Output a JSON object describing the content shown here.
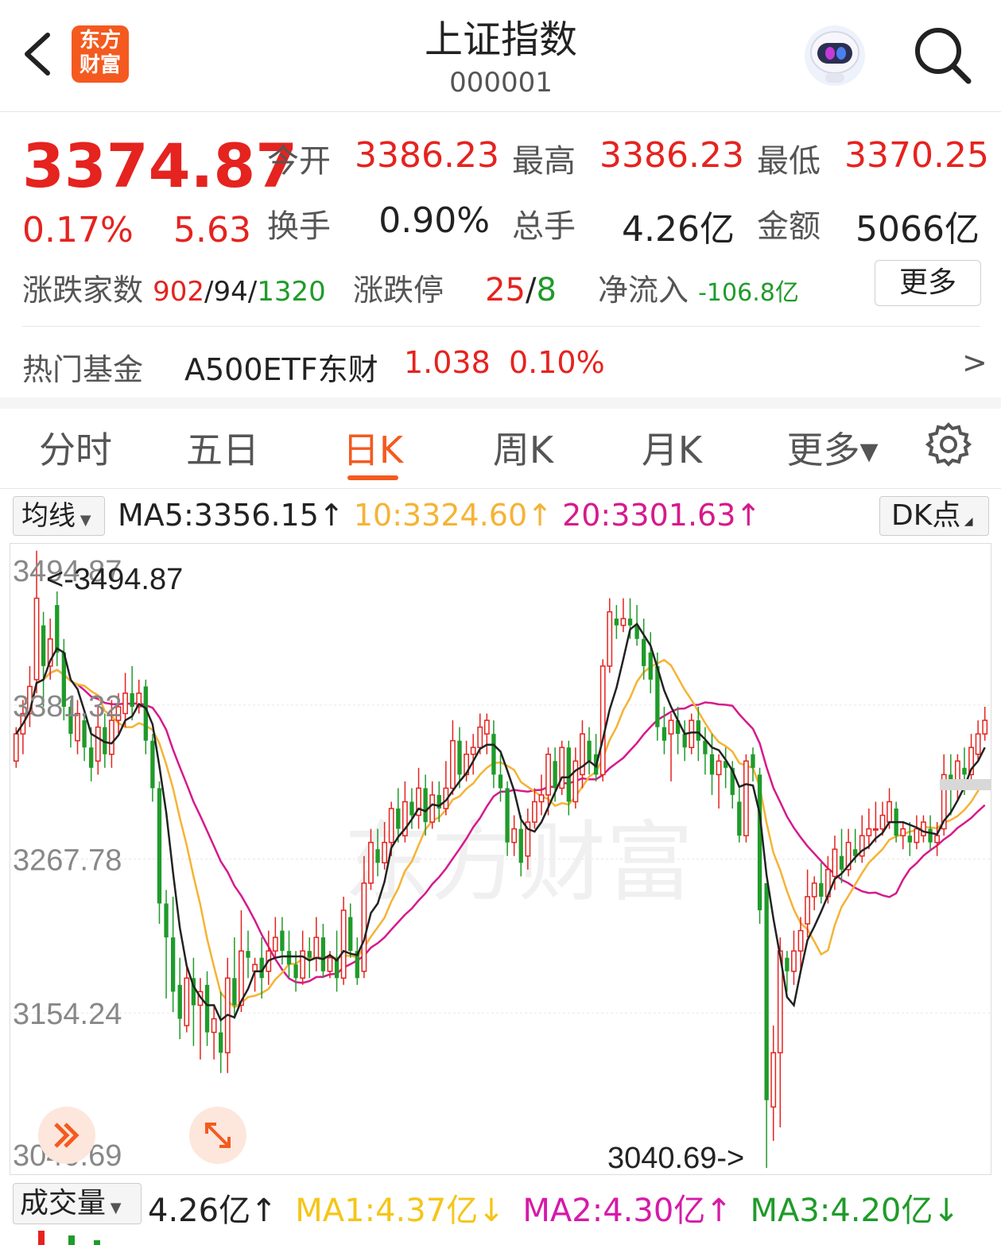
{
  "header": {
    "title": "上证指数",
    "code": "000001",
    "logo_line1": "东方",
    "logo_line2": "财富"
  },
  "quote": {
    "price": "3374.87",
    "change_pct": "0.17%",
    "change": "5.63",
    "open_label": "今开",
    "open": "3386.23",
    "high_label": "最高",
    "high": "3386.23",
    "low_label": "最低",
    "low": "3370.25",
    "turnover_label": "换手",
    "turnover": "0.90%",
    "volume_label": "总手",
    "volume": "4.26亿",
    "amount_label": "金额",
    "amount": "5066亿",
    "breadth_label": "涨跌家数",
    "breadth_up": "902",
    "breadth_flat": "94",
    "breadth_down": "1320",
    "limit_label": "涨跌停",
    "limit_up": "25",
    "limit_down": "8",
    "netflow_label": "净流入",
    "netflow": "-106.8亿",
    "more_label": "更多"
  },
  "fund": {
    "label": "热门基金",
    "name": "A500ETF东财",
    "price": "1.038",
    "pct": "0.10%",
    "arrow": ">"
  },
  "tabs": [
    "分时",
    "五日",
    "日K",
    "周K",
    "月K",
    "更多▾"
  ],
  "active_tab": "日K",
  "ma": {
    "selector": "均线",
    "ma5": "MA5:3356.15↑",
    "ma10": "10:3324.60↑",
    "ma20": "20:3301.63↑",
    "dk": "DK点"
  },
  "volume_bar": {
    "selector": "成交量",
    "value": "4.26亿↑",
    "ma1": "MA1:4.37亿↓",
    "ma2": "MA2:4.30亿↑",
    "ma3": "MA3:4.20亿↓"
  },
  "colors": {
    "up": "#e5231f",
    "down": "#1f9b2a",
    "ma5": "#222222",
    "ma10": "#f5b335",
    "ma20": "#d61a8c",
    "accent": "#f45a1f"
  },
  "chart_data": {
    "type": "candlestick",
    "y_ticks": [
      "3494.87",
      "3381.32",
      "3267.78",
      "3154.24",
      "3040.69"
    ],
    "ylim": [
      3040.69,
      3494.87
    ],
    "max_label": "<-3494.87",
    "min_label": "3040.69->",
    "watermark": "东方财富",
    "candles": [
      [
        3340,
        3360,
        3335,
        3365
      ],
      [
        3360,
        3375,
        3345,
        3385
      ],
      [
        3375,
        3395,
        3365,
        3410
      ],
      [
        3400,
        3460,
        3390,
        3495
      ],
      [
        3440,
        3410,
        3380,
        3450
      ],
      [
        3410,
        3430,
        3400,
        3445
      ],
      [
        3455,
        3420,
        3410,
        3465
      ],
      [
        3420,
        3380,
        3370,
        3430
      ],
      [
        3380,
        3360,
        3350,
        3385
      ],
      [
        3355,
        3375,
        3345,
        3385
      ],
      [
        3370,
        3350,
        3340,
        3375
      ],
      [
        3350,
        3335,
        3325,
        3365
      ],
      [
        3340,
        3365,
        3330,
        3380
      ],
      [
        3365,
        3345,
        3335,
        3375
      ],
      [
        3345,
        3370,
        3335,
        3385
      ],
      [
        3370,
        3380,
        3360,
        3390
      ],
      [
        3375,
        3390,
        3365,
        3405
      ],
      [
        3390,
        3380,
        3370,
        3410
      ],
      [
        3380,
        3390,
        3375,
        3400
      ],
      [
        3395,
        3355,
        3345,
        3400
      ],
      [
        3355,
        3320,
        3310,
        3360
      ],
      [
        3320,
        3235,
        3220,
        3325
      ],
      [
        3235,
        3210,
        3165,
        3245
      ],
      [
        3210,
        3170,
        3155,
        3240
      ],
      [
        3175,
        3150,
        3135,
        3195
      ],
      [
        3145,
        3180,
        3140,
        3190
      ],
      [
        3180,
        3160,
        3130,
        3195
      ],
      [
        3160,
        3170,
        3120,
        3180
      ],
      [
        3175,
        3140,
        3130,
        3185
      ],
      [
        3140,
        3150,
        3120,
        3160
      ],
      [
        3140,
        3125,
        3110,
        3170
      ],
      [
        3125,
        3180,
        3110,
        3195
      ],
      [
        3180,
        3160,
        3150,
        3210
      ],
      [
        3160,
        3200,
        3155,
        3230
      ],
      [
        3200,
        3195,
        3180,
        3215
      ],
      [
        3185,
        3190,
        3170,
        3195
      ],
      [
        3195,
        3180,
        3165,
        3210
      ],
      [
        3185,
        3200,
        3175,
        3215
      ],
      [
        3200,
        3210,
        3195,
        3225
      ],
      [
        3215,
        3200,
        3190,
        3225
      ],
      [
        3200,
        3190,
        3180,
        3215
      ],
      [
        3190,
        3180,
        3170,
        3200
      ],
      [
        3180,
        3200,
        3175,
        3215
      ],
      [
        3200,
        3195,
        3180,
        3210
      ],
      [
        3195,
        3210,
        3185,
        3225
      ],
      [
        3210,
        3185,
        3180,
        3220
      ],
      [
        3185,
        3195,
        3180,
        3200
      ],
      [
        3195,
        3180,
        3170,
        3215
      ],
      [
        3180,
        3230,
        3175,
        3240
      ],
      [
        3225,
        3200,
        3195,
        3235
      ],
      [
        3200,
        3180,
        3175,
        3210
      ],
      [
        3185,
        3250,
        3180,
        3270
      ],
      [
        3250,
        3280,
        3245,
        3290
      ],
      [
        3275,
        3265,
        3255,
        3290
      ],
      [
        3265,
        3280,
        3260,
        3295
      ],
      [
        3280,
        3305,
        3270,
        3310
      ],
      [
        3305,
        3290,
        3280,
        3320
      ],
      [
        3285,
        3310,
        3280,
        3325
      ],
      [
        3310,
        3300,
        3290,
        3320
      ],
      [
        3300,
        3320,
        3290,
        3335
      ],
      [
        3320,
        3295,
        3285,
        3330
      ],
      [
        3295,
        3315,
        3290,
        3325
      ],
      [
        3315,
        3305,
        3295,
        3325
      ],
      [
        3305,
        3320,
        3300,
        3340
      ],
      [
        3320,
        3355,
        3315,
        3370
      ],
      [
        3355,
        3330,
        3320,
        3365
      ],
      [
        3330,
        3345,
        3325,
        3355
      ],
      [
        3345,
        3350,
        3330,
        3360
      ],
      [
        3350,
        3365,
        3345,
        3375
      ],
      [
        3360,
        3370,
        3345,
        3375
      ],
      [
        3360,
        3330,
        3320,
        3370
      ],
      [
        3330,
        3320,
        3310,
        3345
      ],
      [
        3320,
        3280,
        3270,
        3325
      ],
      [
        3280,
        3290,
        3270,
        3300
      ],
      [
        3290,
        3265,
        3255,
        3300
      ],
      [
        3270,
        3295,
        3260,
        3305
      ],
      [
        3295,
        3310,
        3290,
        3320
      ],
      [
        3310,
        3315,
        3300,
        3330
      ],
      [
        3315,
        3345,
        3300,
        3350
      ],
      [
        3340,
        3320,
        3310,
        3350
      ],
      [
        3320,
        3350,
        3315,
        3355
      ],
      [
        3350,
        3310,
        3300,
        3355
      ],
      [
        3310,
        3340,
        3305,
        3350
      ],
      [
        3330,
        3360,
        3320,
        3370
      ],
      [
        3355,
        3340,
        3330,
        3365
      ],
      [
        3345,
        3330,
        3325,
        3360
      ],
      [
        3330,
        3410,
        3325,
        3415
      ],
      [
        3410,
        3450,
        3405,
        3460
      ],
      [
        3445,
        3440,
        3430,
        3455
      ],
      [
        3440,
        3445,
        3435,
        3460
      ],
      [
        3445,
        3440,
        3430,
        3460
      ],
      [
        3440,
        3430,
        3425,
        3455
      ],
      [
        3430,
        3410,
        3400,
        3445
      ],
      [
        3420,
        3400,
        3390,
        3435
      ],
      [
        3410,
        3365,
        3355,
        3420
      ],
      [
        3365,
        3355,
        3345,
        3380
      ],
      [
        3360,
        3370,
        3325,
        3375
      ],
      [
        3370,
        3360,
        3345,
        3380
      ],
      [
        3360,
        3350,
        3340,
        3370
      ],
      [
        3350,
        3370,
        3345,
        3375
      ],
      [
        3370,
        3355,
        3340,
        3380
      ],
      [
        3355,
        3345,
        3330,
        3365
      ],
      [
        3345,
        3330,
        3315,
        3360
      ],
      [
        3330,
        3340,
        3305,
        3345
      ],
      [
        3340,
        3335,
        3320,
        3350
      ],
      [
        3335,
        3315,
        3305,
        3340
      ],
      [
        3310,
        3285,
        3280,
        3320
      ],
      [
        3285,
        3340,
        3280,
        3345
      ],
      [
        3345,
        3335,
        3325,
        3350
      ],
      [
        3330,
        3230,
        3220,
        3335
      ],
      [
        3250,
        3090,
        3040,
        3250
      ],
      [
        3085,
        3125,
        3060,
        3145
      ],
      [
        3125,
        3200,
        3070,
        3210
      ],
      [
        3195,
        3185,
        3170,
        3200
      ],
      [
        3185,
        3200,
        3175,
        3215
      ],
      [
        3200,
        3215,
        3185,
        3225
      ],
      [
        3220,
        3240,
        3210,
        3260
      ],
      [
        3240,
        3250,
        3230,
        3255
      ],
      [
        3250,
        3240,
        3235,
        3265
      ],
      [
        3240,
        3260,
        3235,
        3270
      ],
      [
        3255,
        3275,
        3245,
        3285
      ],
      [
        3270,
        3260,
        3250,
        3290
      ],
      [
        3260,
        3280,
        3255,
        3290
      ],
      [
        3275,
        3270,
        3265,
        3290
      ],
      [
        3270,
        3285,
        3265,
        3300
      ],
      [
        3285,
        3290,
        3275,
        3305
      ],
      [
        3290,
        3290,
        3280,
        3310
      ],
      [
        3290,
        3300,
        3285,
        3310
      ],
      [
        3295,
        3310,
        3290,
        3320
      ],
      [
        3305,
        3285,
        3280,
        3310
      ],
      [
        3285,
        3290,
        3275,
        3295
      ],
      [
        3285,
        3280,
        3270,
        3295
      ],
      [
        3280,
        3290,
        3275,
        3300
      ],
      [
        3285,
        3295,
        3280,
        3300
      ],
      [
        3290,
        3280,
        3275,
        3300
      ],
      [
        3280,
        3285,
        3270,
        3295
      ],
      [
        3290,
        3330,
        3285,
        3345
      ],
      [
        3330,
        3320,
        3300,
        3345
      ],
      [
        3320,
        3340,
        3310,
        3345
      ],
      [
        3335,
        3330,
        3315,
        3350
      ],
      [
        3330,
        3350,
        3325,
        3360
      ],
      [
        3345,
        3360,
        3340,
        3370
      ],
      [
        3360,
        3370,
        3355,
        3380
      ]
    ],
    "ma5_label": "MA5",
    "ma10_label": "10",
    "ma20_label": "20"
  }
}
